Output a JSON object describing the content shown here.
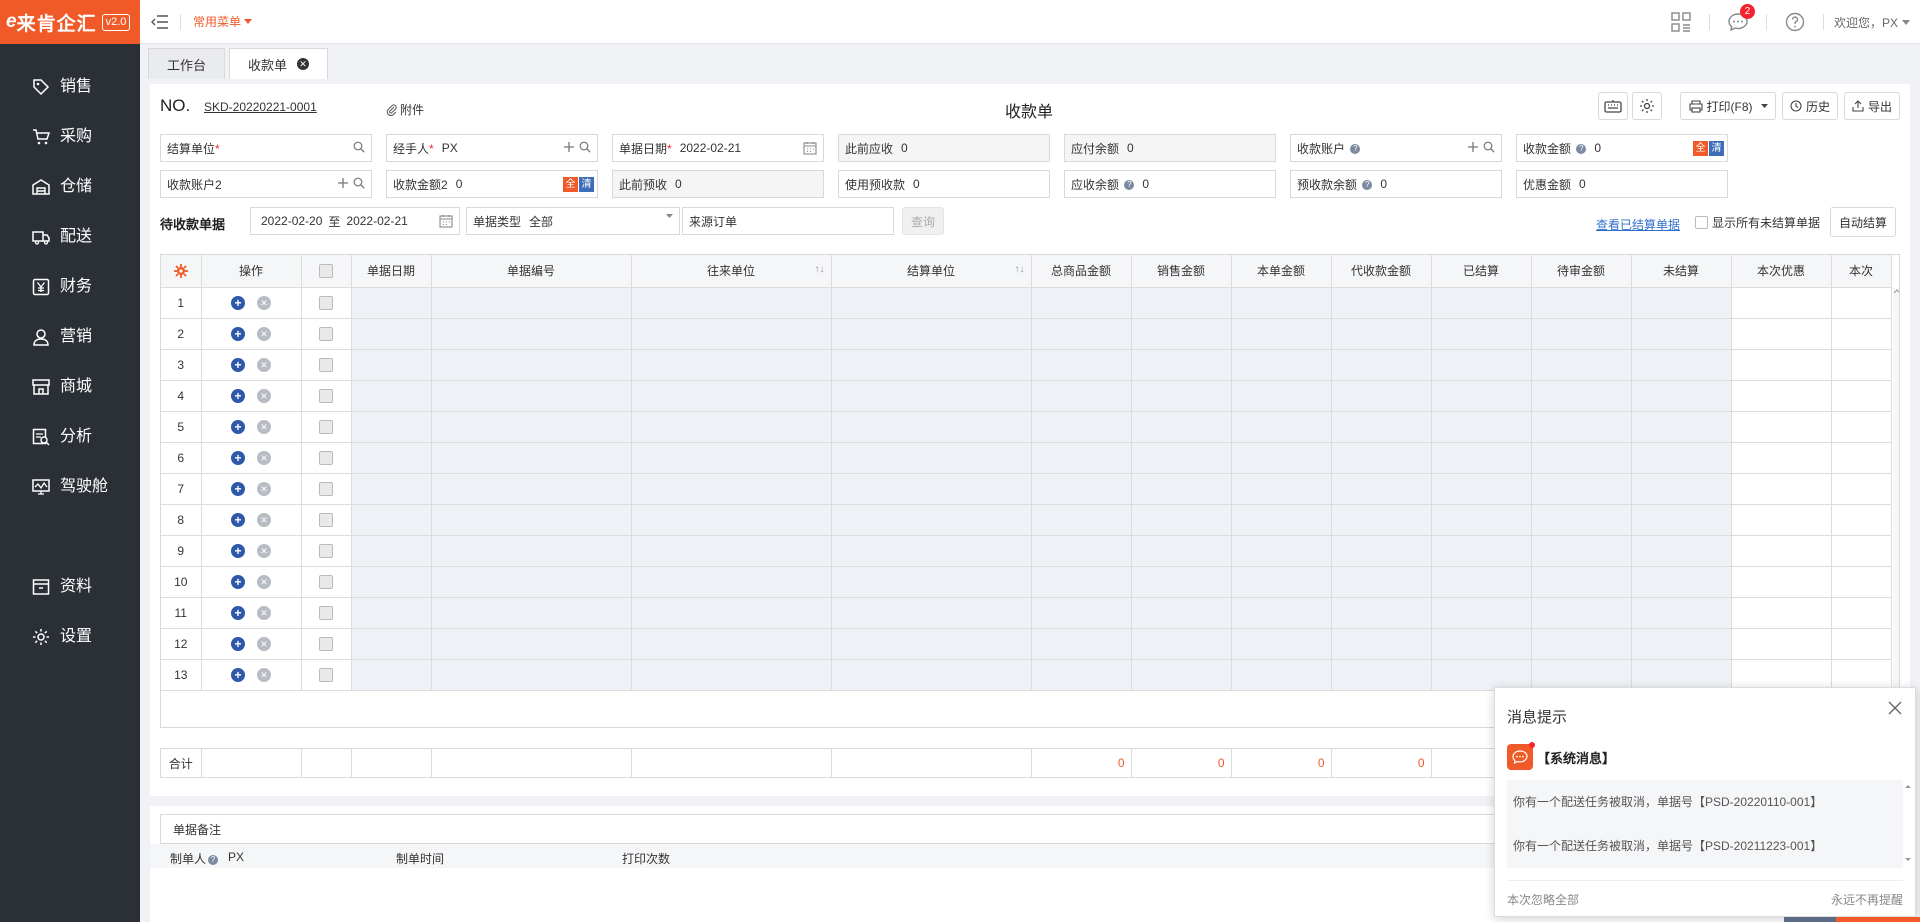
{
  "app": {
    "logo_mark": "e",
    "logo_text": "来肯企汇",
    "version": "v2.0"
  },
  "sidebar": {
    "groups": [
      [
        {
          "label": "销售",
          "icon": "tag-icon"
        },
        {
          "label": "采购",
          "icon": "cart-icon"
        },
        {
          "label": "仓储",
          "icon": "warehouse-icon"
        },
        {
          "label": "配送",
          "icon": "truck-icon"
        },
        {
          "label": "财务",
          "icon": "yen-icon"
        },
        {
          "label": "营销",
          "icon": "marketing-icon"
        },
        {
          "label": "商城",
          "icon": "store-icon"
        },
        {
          "label": "分析",
          "icon": "analysis-icon"
        },
        {
          "label": "驾驶舱",
          "icon": "dashboard-icon"
        }
      ],
      [
        {
          "label": "资料",
          "icon": "archive-icon"
        },
        {
          "label": "设置",
          "icon": "gear-icon"
        }
      ]
    ]
  },
  "topbar": {
    "common_menu": "常用菜单",
    "badge_count": "2",
    "welcome": "欢迎您，PX"
  },
  "tabs": [
    {
      "label": "工作台",
      "active": false,
      "closable": false
    },
    {
      "label": "收款单",
      "active": true,
      "closable": true
    }
  ],
  "header": {
    "no_label": "NO.",
    "no_value": "SKD-20220221-0001",
    "attachment": "附件",
    "title": "收款单",
    "print_label": "打印(F8)",
    "history_label": "历史",
    "export_label": "导出"
  },
  "form": {
    "rows": [
      [
        {
          "label": "结算单位",
          "required": true,
          "value": "",
          "icons": [
            "search"
          ],
          "readonly": false
        },
        {
          "label": "经手人",
          "required": true,
          "value": "PX",
          "icons": [
            "plus",
            "search"
          ],
          "readonly": false
        },
        {
          "label": "单据日期",
          "required": true,
          "value": "2022-02-21",
          "icons": [
            "calendar"
          ],
          "readonly": false
        },
        {
          "label": "此前应收",
          "value": "0",
          "readonly": true
        },
        {
          "label": "应付余额",
          "value": "0",
          "readonly": true
        },
        {
          "label": "收款账户",
          "help": true,
          "value": "",
          "icons": [
            "plus",
            "search"
          ],
          "readonly": false
        },
        {
          "label": "收款金额",
          "help": true,
          "value": "0",
          "quick": true,
          "readonly": false
        }
      ],
      [
        {
          "label": "收款账户2",
          "value": "",
          "icons": [
            "plus",
            "search"
          ],
          "readonly": false
        },
        {
          "label": "收款金额2",
          "value": "0",
          "quick": true,
          "readonly": false
        },
        {
          "label": "此前预收",
          "value": "0",
          "readonly": true
        },
        {
          "label": "使用预收款",
          "value": "0",
          "readonly": false
        },
        {
          "label": "应收余额",
          "help": true,
          "value": "0",
          "readonly": false
        },
        {
          "label": "预收款余额",
          "help": true,
          "value": "0",
          "readonly": false
        },
        {
          "label": "优惠金额",
          "value": "0",
          "readonly": false
        }
      ]
    ],
    "quick_all": "全",
    "quick_clear": "清"
  },
  "pending": {
    "label": "待收款单据",
    "date_from": "2022-02-20",
    "date_sep": "至",
    "date_to": "2022-02-21",
    "type_label": "单据类型",
    "type_value": "全部",
    "source_value": "来源订单",
    "query_label": "查询",
    "view_settled": "查看已结算单据",
    "show_unsettled": "显示所有未结算单据",
    "auto_settle": "自动结算"
  },
  "table": {
    "columns": [
      {
        "label": "",
        "w": 40
      },
      {
        "label": "操作",
        "w": 100
      },
      {
        "label": "",
        "w": 50,
        "type": "checkbox"
      },
      {
        "label": "单据日期",
        "w": 80
      },
      {
        "label": "单据编号",
        "w": 200
      },
      {
        "label": "往来单位",
        "w": 200,
        "sort": true
      },
      {
        "label": "结算单位",
        "w": 200,
        "sort": true
      },
      {
        "label": "总商品金额",
        "w": 100
      },
      {
        "label": "销售金额",
        "w": 100
      },
      {
        "label": "本单金额",
        "w": 100
      },
      {
        "label": "代收款金额",
        "w": 100
      },
      {
        "label": "已结算",
        "w": 100
      },
      {
        "label": "待审金额",
        "w": 100
      },
      {
        "label": "未结算",
        "w": 100
      },
      {
        "label": "本次优惠",
        "w": 100
      },
      {
        "label": "本次",
        "w": 60
      }
    ],
    "rows": [
      "1",
      "2",
      "3",
      "4",
      "5",
      "6",
      "7",
      "8",
      "9",
      "10",
      "11",
      "12",
      "13"
    ],
    "sum_label": "合计",
    "sum_values": [
      "0",
      "0",
      "0",
      "0"
    ]
  },
  "remark": {
    "label": "单据备注"
  },
  "footer": {
    "maker_label": "制单人",
    "maker_value": "PX",
    "time_label": "制单时间",
    "print_count_label": "打印次数"
  },
  "popup": {
    "title": "消息提示",
    "sys_label": "【系统消息】",
    "messages": [
      "你有一个配送任务被取消，单据号【PSD-20220110-001】",
      "你有一个配送任务被取消，单据号【PSD-20211223-001】"
    ],
    "ignore_all": "本次忽略全部",
    "never_remind": "永远不再提醒"
  },
  "colors": {
    "brand": "#f05a28",
    "sidebar": "#2b2f36",
    "accent_blue": "#2d59a8",
    "link": "#2f6fce"
  }
}
